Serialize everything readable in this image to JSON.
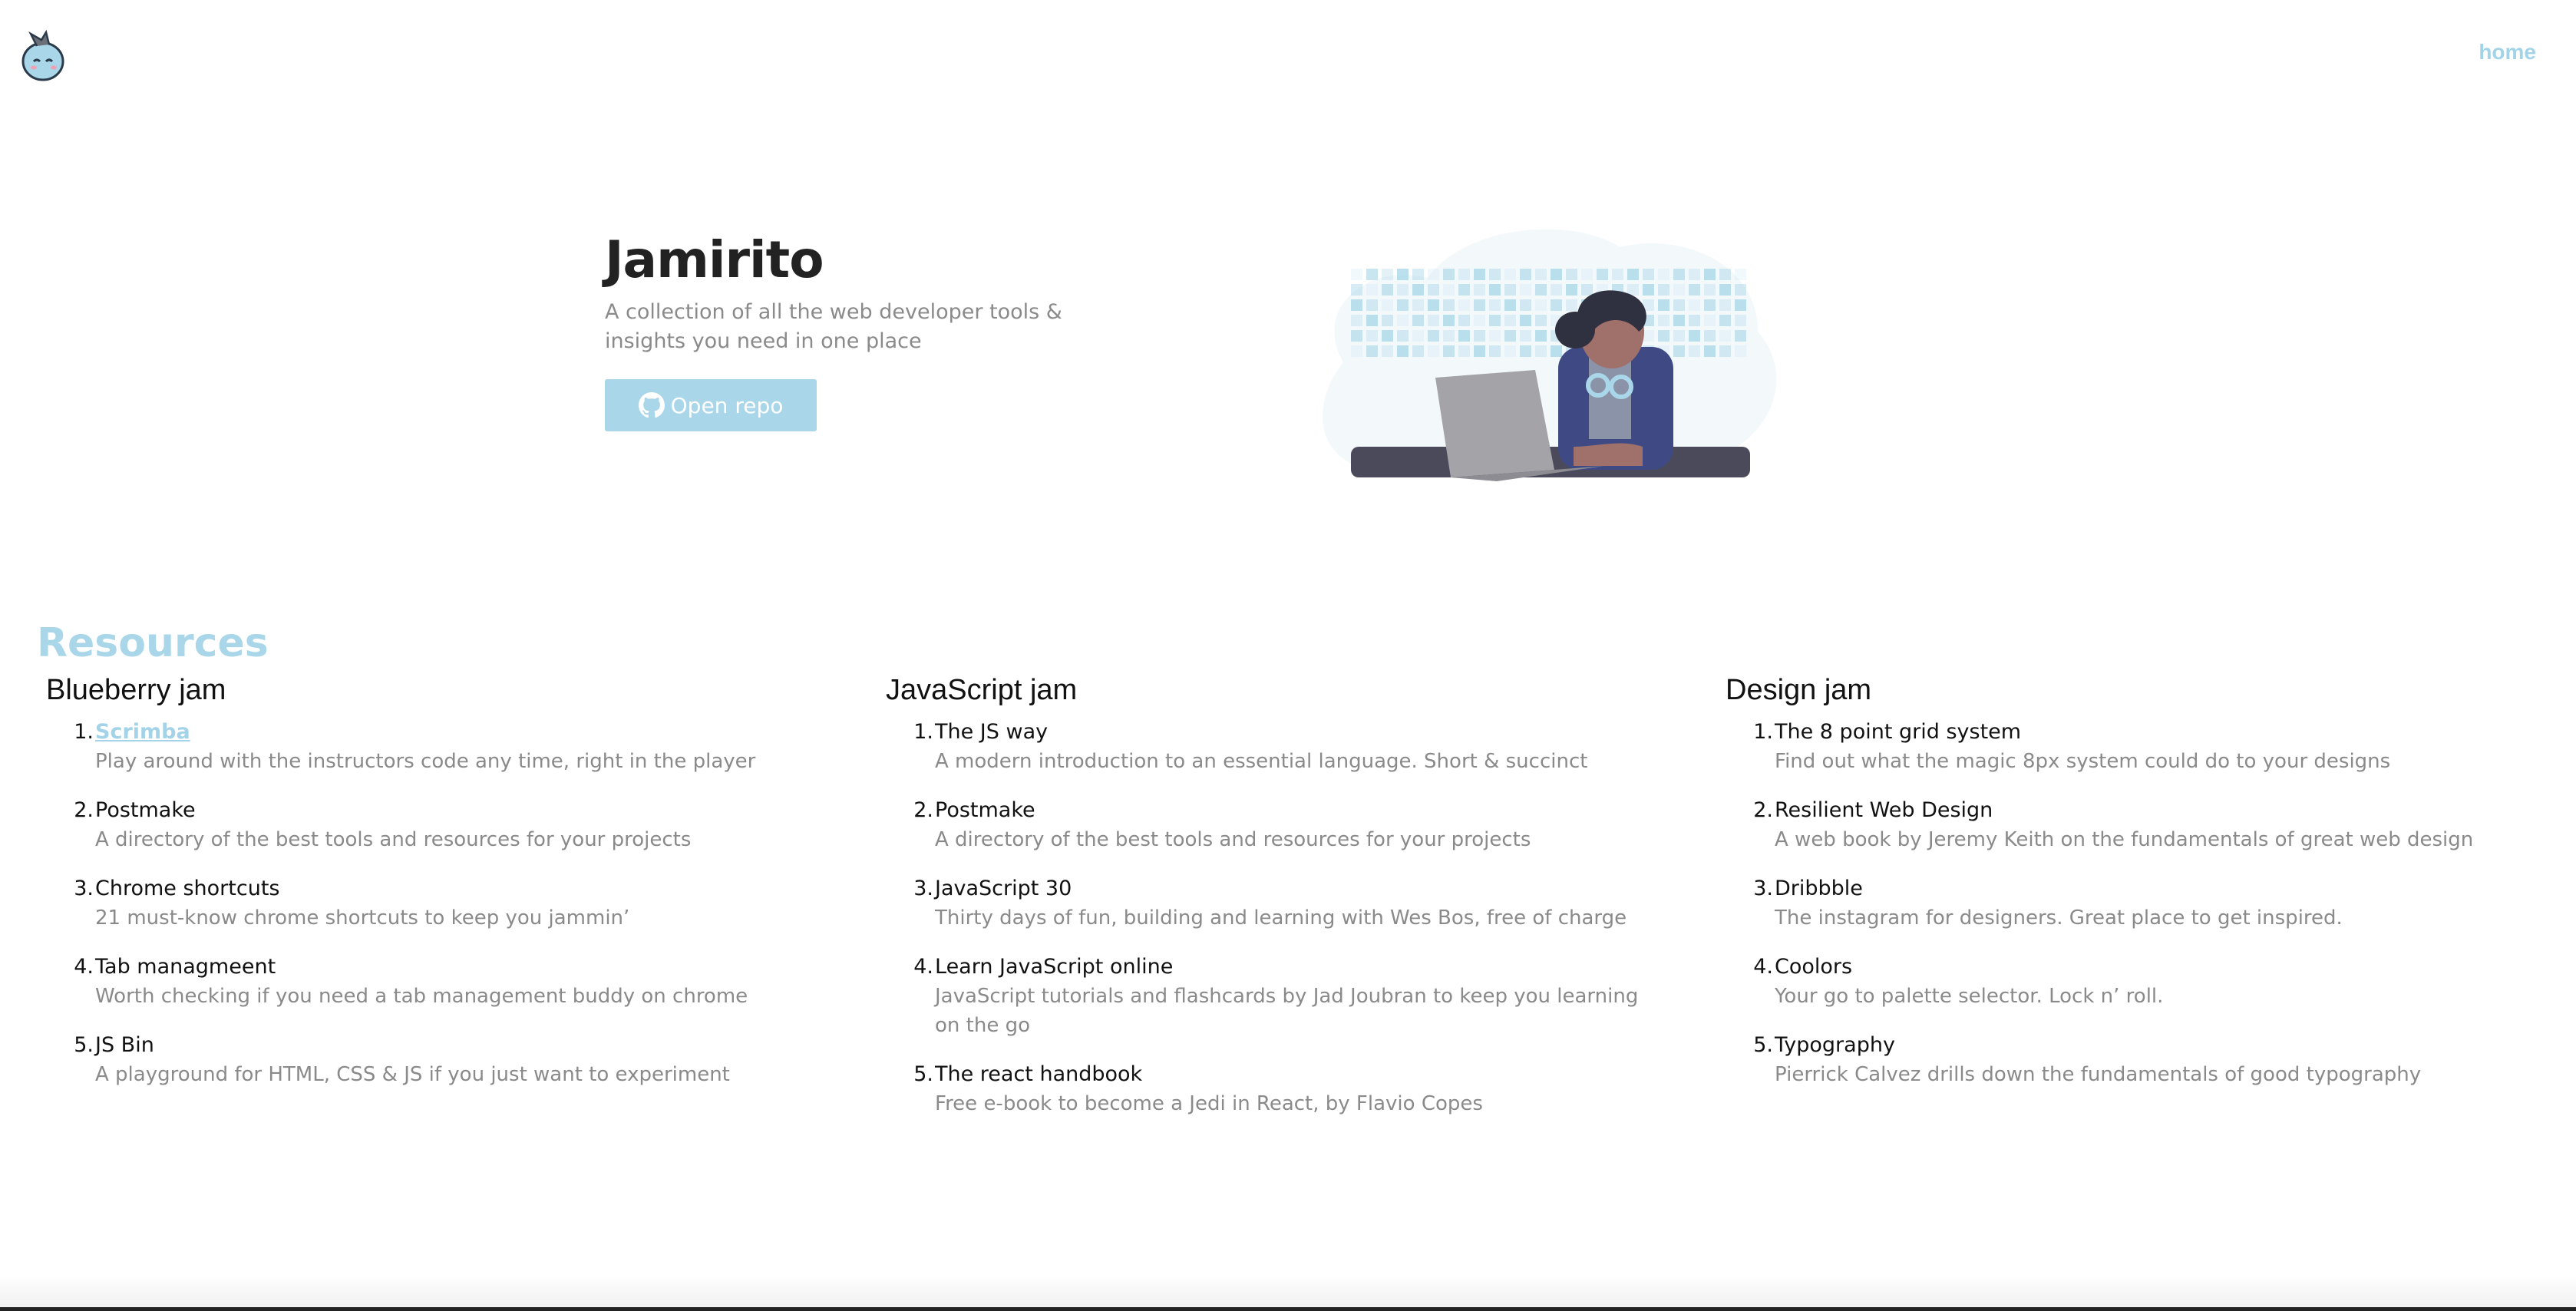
{
  "header": {
    "logo_icon": "jam-mascot-logo",
    "nav_home": "home",
    "accent": "#a3d3e8"
  },
  "hero": {
    "title": "Jamirito",
    "subtitle": "A collection of all the web developer tools & insights you need in one place",
    "button_label": "Open repo",
    "button_icon": "github-icon",
    "illustration": "developer-on-laptop"
  },
  "resources": {
    "heading": "Resources",
    "columns": [
      {
        "title": "Blueberry jam",
        "items": [
          {
            "num": "1.",
            "title": "Scrimba",
            "desc": "Play around with the instructors code any time, right in the player"
          },
          {
            "num": "2.",
            "title": "Postmake",
            "desc": "A directory of the best tools and resources for your projects"
          },
          {
            "num": "3.",
            "title": "Chrome shortcuts",
            "desc": "21 must-know chrome shortcuts to keep you jammin’"
          },
          {
            "num": "4.",
            "title": "Tab managmeent",
            "desc": "Worth checking if you need a tab management buddy on chrome"
          },
          {
            "num": "5.",
            "title": "JS Bin",
            "desc": "A playground for HTML, CSS & JS if you just want to experiment"
          }
        ]
      },
      {
        "title": "JavaScript jam",
        "items": [
          {
            "num": "1.",
            "title": "The JS way",
            "desc": "A modern introduction to an essential language. Short & succinct"
          },
          {
            "num": "2.",
            "title": "Postmake",
            "desc": "A directory of the best tools and resources for your projects"
          },
          {
            "num": "3.",
            "title": "JavaScript 30",
            "desc": "Thirty days of fun, building and learning with Wes Bos, free of charge"
          },
          {
            "num": "4.",
            "title": "Learn JavaScript online",
            "desc": "JavaScript tutorials and flashcards by Jad Joubran to keep you learning on the go"
          },
          {
            "num": "5.",
            "title": "The react handbook",
            "desc": "Free e-book to become a Jedi in React, by Flavio Copes"
          }
        ]
      },
      {
        "title": "Design jam",
        "items": [
          {
            "num": "1.",
            "title": "The 8 point grid system",
            "desc": "Find out what the magic 8px system could do to your designs"
          },
          {
            "num": "2.",
            "title": "Resilient Web Design",
            "desc": "A web book by Jeremy Keith on the fundamentals of great web design"
          },
          {
            "num": "3.",
            "title": "Dribbble",
            "desc": "The instagram for designers. Great place to get inspired."
          },
          {
            "num": "4.",
            "title": "Coolors",
            "desc": "Your go to palette selector. Lock n’ roll."
          },
          {
            "num": "5.",
            "title": "Typography",
            "desc": "Pierrick Calvez drills down the fundamentals of good typography"
          }
        ]
      }
    ]
  }
}
